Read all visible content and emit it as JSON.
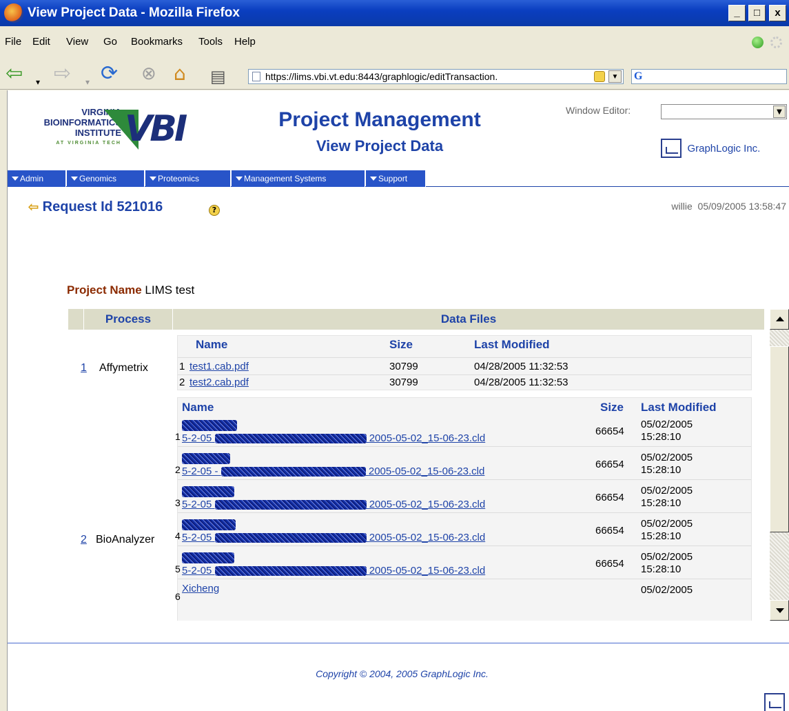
{
  "window": {
    "title": "View Project Data - Mozilla Firefox",
    "buttons": [
      "_",
      "□",
      "x"
    ]
  },
  "menubar": {
    "items": [
      "File",
      "Edit",
      "View",
      "Go",
      "Bookmarks",
      "Tools",
      "Help"
    ]
  },
  "navbar": {
    "url": "https://lims.vbi.vt.edu:8443/graphlogic/editTransaction.",
    "search_engine_glyph": "G"
  },
  "header": {
    "logo": {
      "line1": "VIRGINIA",
      "line2": "BIOINFORMATICS",
      "line3": "INSTITUTE",
      "line4": "AT VIRGINIA TECH",
      "mark": "VBI"
    },
    "title": "Project Management",
    "subtitle": "View Project Data",
    "window_editor_label": "Window Editor:",
    "window_editor_value": "",
    "company": "GraphLogic Inc."
  },
  "nav_tabs": [
    "Admin",
    "Genomics",
    "Proteomics",
    "Management Systems",
    "Support"
  ],
  "request": {
    "label": "Request Id 521016",
    "user": "willie",
    "timestamp": "05/09/2005 13:58:47"
  },
  "project": {
    "name_label": "Project Name",
    "name": "LIMS test"
  },
  "table": {
    "headers": {
      "process": "Process",
      "data_files": "Data Files"
    },
    "processes": [
      {
        "num": "1",
        "name": "Affymetrix",
        "file_headers": {
          "name": "Name",
          "size": "Size",
          "modified": "Last Modified"
        },
        "files": [
          {
            "idx": "1",
            "name": "test1.cab.pdf",
            "size": "30799",
            "modified": "04/28/2005 11:32:53"
          },
          {
            "idx": "2",
            "name": "test2.cab.pdf",
            "size": "30799",
            "modified": "04/28/2005 11:32:53"
          }
        ]
      },
      {
        "num": "2",
        "name": "BioAnalyzer",
        "file_headers": {
          "name": "Name",
          "size": "Size",
          "modified": "Last Modified"
        },
        "files": [
          {
            "idx": "1",
            "prefix": "5-2-05",
            "suffix": "2005-05-02_15-06-23.cld",
            "size": "66654",
            "date": "05/02/2005",
            "time": "15:28:10"
          },
          {
            "idx": "2",
            "prefix": "5-2-05 -",
            "suffix": "2005-05-02_15-06-23.cld",
            "size": "66654",
            "date": "05/02/2005",
            "time": "15:28:10"
          },
          {
            "idx": "3",
            "prefix": "5-2-05",
            "suffix": "2005-05-02_15-06-23.cld",
            "size": "66654",
            "date": "05/02/2005",
            "time": "15:28:10"
          },
          {
            "idx": "4",
            "prefix": "5-2-05",
            "suffix": "2005-05-02_15-06-23.cld",
            "size": "66654",
            "date": "05/02/2005",
            "time": "15:28:10"
          },
          {
            "idx": "5",
            "prefix": "5-2-05",
            "suffix": "2005-05-02_15-06-23.cld",
            "size": "66654",
            "date": "05/02/2005",
            "time": "15:28:10"
          },
          {
            "idx": "6",
            "prefix": "Xicheng",
            "suffix": "",
            "size": "",
            "date": "05/02/2005",
            "time": ""
          }
        ]
      }
    ]
  },
  "footer": {
    "copyright": "Copyright © 2004, 2005 GraphLogic Inc."
  },
  "colors": {
    "titlebar": "#0a3ec0",
    "brand_blue": "#1e43a8",
    "nav_tab_bg": "#2854c8",
    "project_label": "#8b2a00",
    "table_header_bg": "#dcdcc8"
  }
}
